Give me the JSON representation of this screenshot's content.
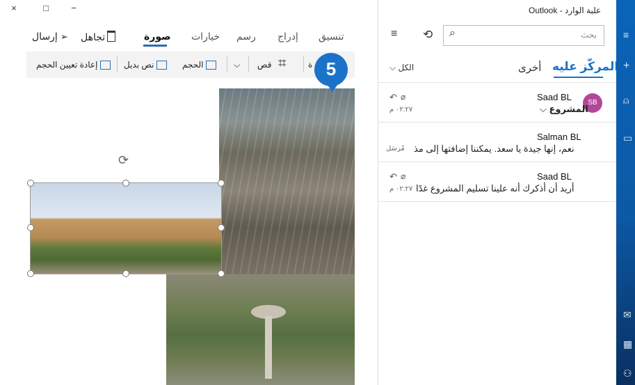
{
  "window": {
    "title": "علبة الوارد - Outlook",
    "close": "×",
    "maximize": "□",
    "minimize": "−"
  },
  "compose": {
    "tabs": [
      {
        "label": "تنسيق"
      },
      {
        "label": "إدراج"
      },
      {
        "label": "رسم"
      },
      {
        "label": "خيارات"
      },
      {
        "label": "صورة"
      }
    ],
    "discard_label": "تجاهل",
    "send_label": "إرسال",
    "ribbon": {
      "reset_size": "إعادة تعيين الحجم",
      "alt_text": "نص بديل",
      "size": "الحجم",
      "crop": "قص",
      "rotate_partial": "ة"
    },
    "step_badge": "5"
  },
  "mail": {
    "search_placeholder": "بحث",
    "focused_tab": "المركّز عليه",
    "other_tab": "أخرى",
    "filter_label": "الكل",
    "messages": [
      {
        "avatar": "SB",
        "sender": "Saad BL",
        "subject": "المشروع",
        "time": "٠٢:٢٧ م"
      },
      {
        "sender": "Salman BL",
        "preview": "نعم، إنها جيدة يا سعد. يمكننا إضافتها إلى مذ",
        "status": "مُرسَل"
      },
      {
        "sender": "Saad BL",
        "preview": "أريد أن أذكرك أنه علينا تسليم المشروع غدًا",
        "time": "٠٢:٢٧ م"
      }
    ]
  },
  "colors": {
    "accent": "#1a73c8",
    "rail": "#0a64b8",
    "avatar": "#b0489a"
  }
}
